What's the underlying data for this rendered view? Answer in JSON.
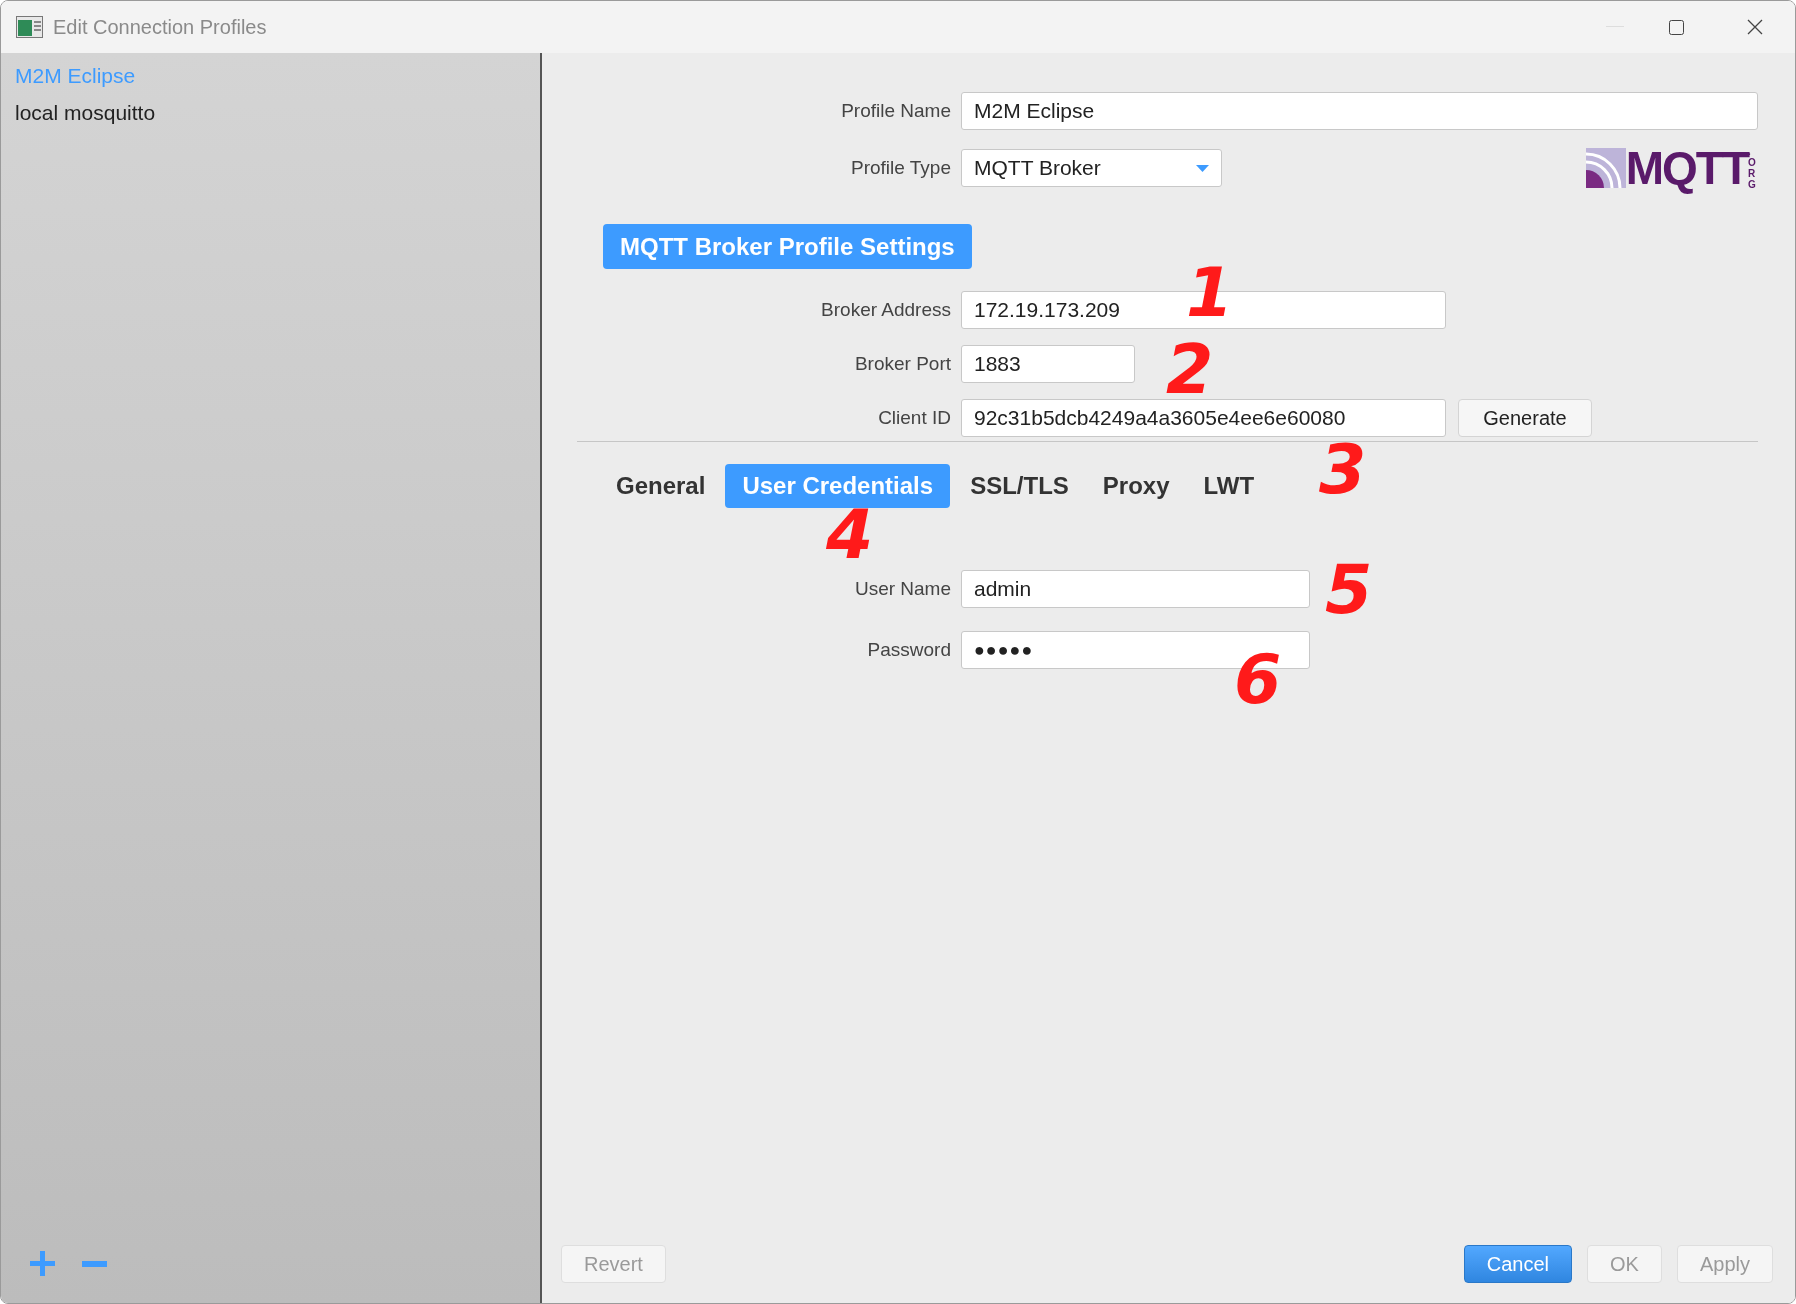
{
  "window": {
    "title": "Edit Connection Profiles"
  },
  "sidebar": {
    "profiles": [
      {
        "label": "M2M Eclipse",
        "selected": true
      },
      {
        "label": "local mosquitto",
        "selected": false
      }
    ]
  },
  "profile_name": {
    "label": "Profile Name",
    "value": "M2M Eclipse"
  },
  "profile_type": {
    "label": "Profile Type",
    "value": "MQTT Broker"
  },
  "logo": {
    "text": "MQTT",
    "suffix": ".ORG"
  },
  "section_header": "MQTT Broker Profile Settings",
  "broker_fields": [
    {
      "label": "Broker Address",
      "value": "172.19.173.209"
    },
    {
      "label": "Broker Port",
      "value": "1883"
    },
    {
      "label": "Client ID",
      "value": "92c31b5dcb4249a4a3605e4ee6e60080"
    }
  ],
  "generate_button": "Generate",
  "tabs": [
    {
      "label": "General",
      "selected": false
    },
    {
      "label": "User Credentials",
      "selected": true
    },
    {
      "label": "SSL/TLS",
      "selected": false
    },
    {
      "label": "Proxy",
      "selected": false
    },
    {
      "label": "LWT",
      "selected": false
    }
  ],
  "credentials": [
    {
      "label": "User Name",
      "value": "admin",
      "kind": "text"
    },
    {
      "label": "Password",
      "value": "●●●●●",
      "kind": "password"
    }
  ],
  "footer_left": [
    {
      "label": "Revert",
      "disabled": true
    }
  ],
  "footer_right": [
    {
      "label": "Cancel",
      "kind": "primary",
      "disabled": false
    },
    {
      "label": "OK",
      "kind": "default",
      "disabled": true
    },
    {
      "label": "Apply",
      "kind": "default",
      "disabled": true
    }
  ],
  "annotations": [
    {
      "text": "1"
    },
    {
      "text": "2"
    },
    {
      "text": "3"
    },
    {
      "text": "4"
    },
    {
      "text": "5"
    },
    {
      "text": "6"
    }
  ]
}
